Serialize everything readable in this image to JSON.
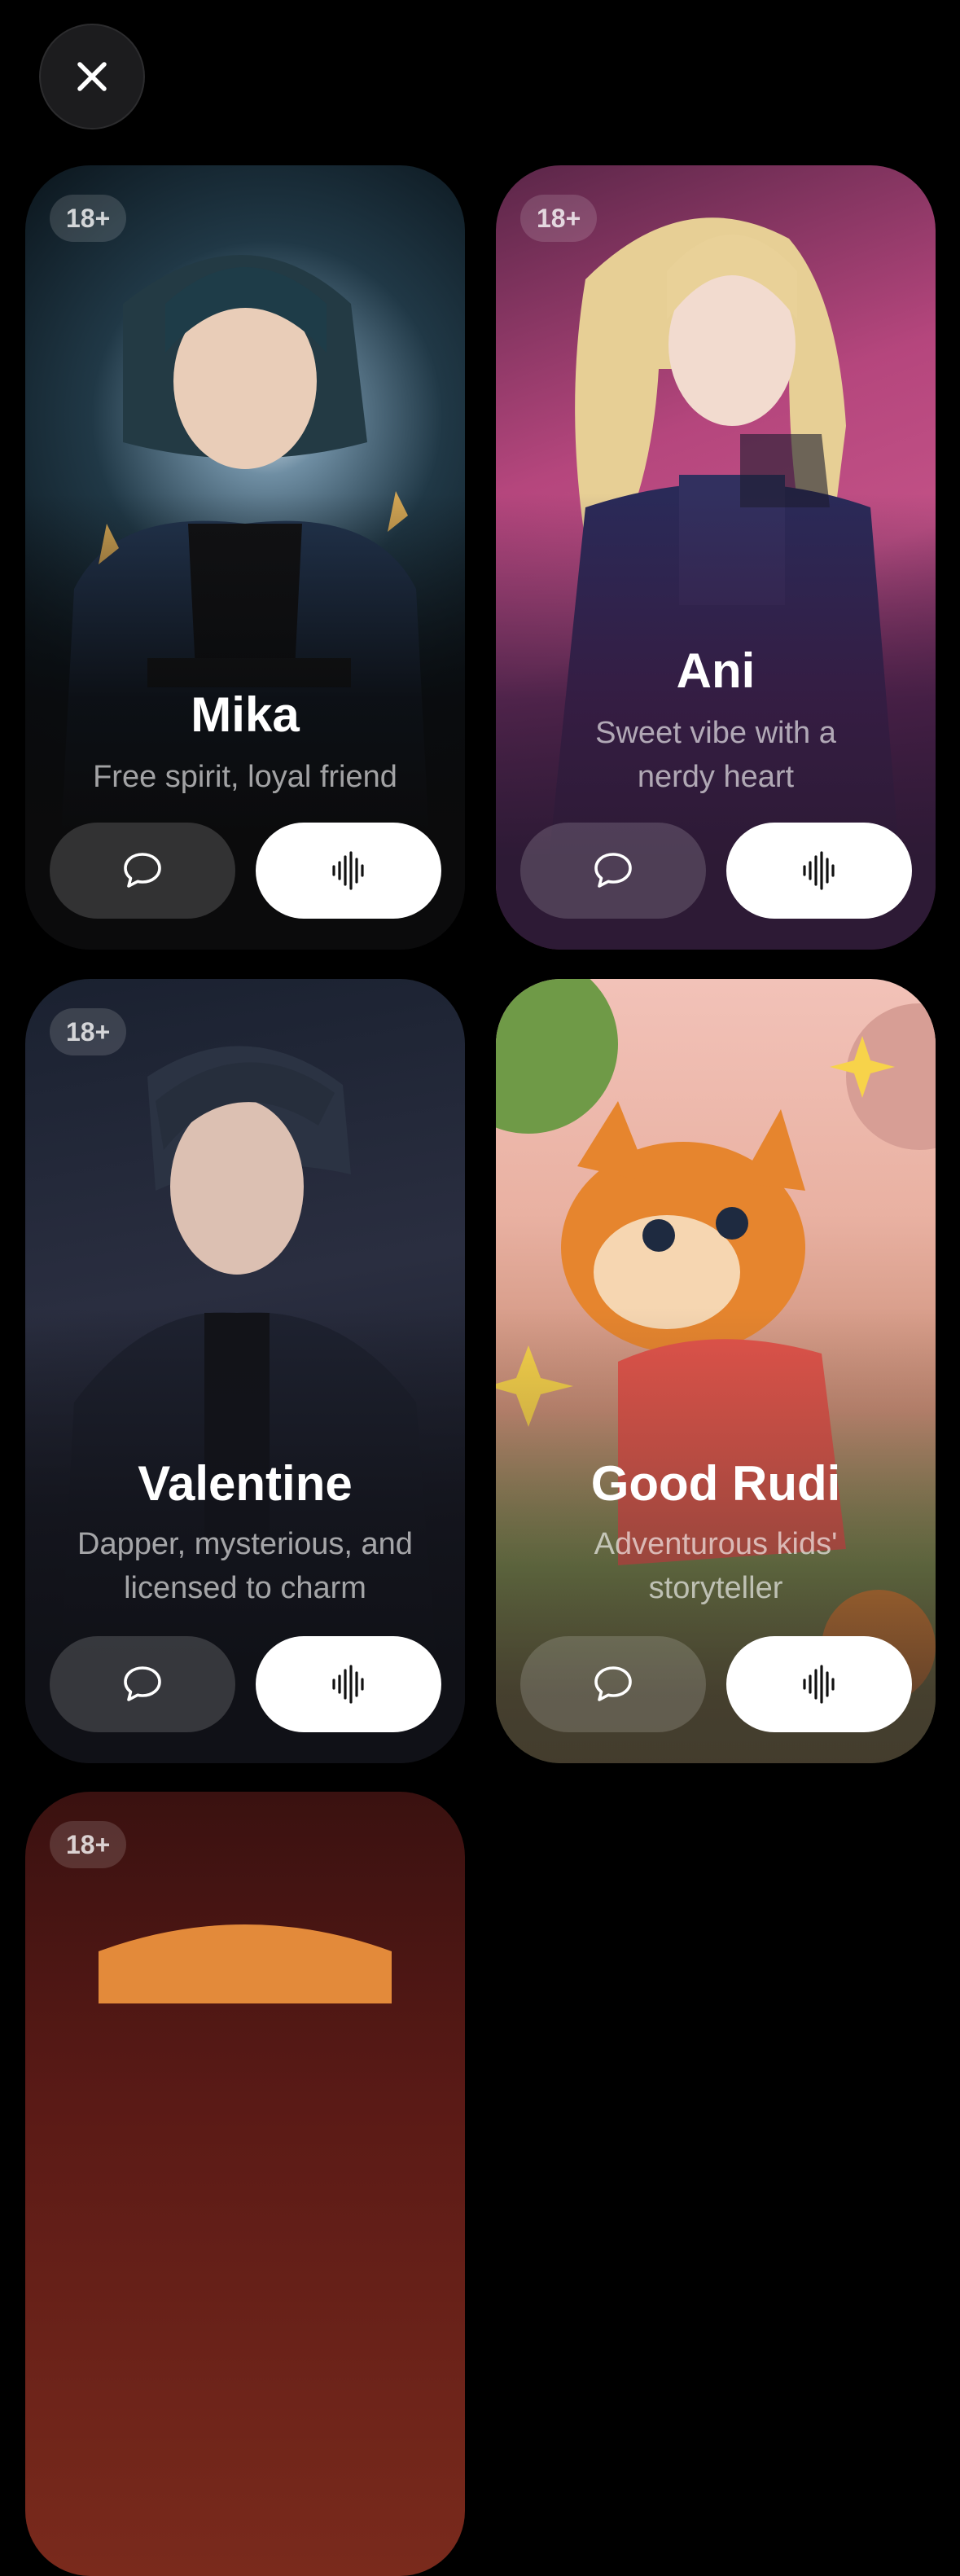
{
  "header": {
    "close_icon": "close-icon"
  },
  "cards": [
    {
      "badge": "18+",
      "name": "Mika",
      "tagline": "Free spirit, loyal friend",
      "chat_icon": "chat-bubble-icon",
      "voice_icon": "waveform-icon"
    },
    {
      "badge": "18+",
      "name": "Ani",
      "tagline": "Sweet vibe with a nerdy heart",
      "chat_icon": "chat-bubble-icon",
      "voice_icon": "waveform-icon"
    },
    {
      "badge": "18+",
      "name": "Valentine",
      "tagline": "Dapper, mysterious, and licensed to charm",
      "chat_icon": "chat-bubble-icon",
      "voice_icon": "waveform-icon"
    },
    {
      "badge": "",
      "name": "Good Rudi",
      "tagline": "Adventurous kids' storyteller",
      "chat_icon": "chat-bubble-icon",
      "voice_icon": "waveform-icon"
    },
    {
      "badge": "18+"
    }
  ],
  "colors": {
    "background": "#000000",
    "voice_button": "#ffffff",
    "chat_button": "rgba(255,255,255,0.16)"
  }
}
